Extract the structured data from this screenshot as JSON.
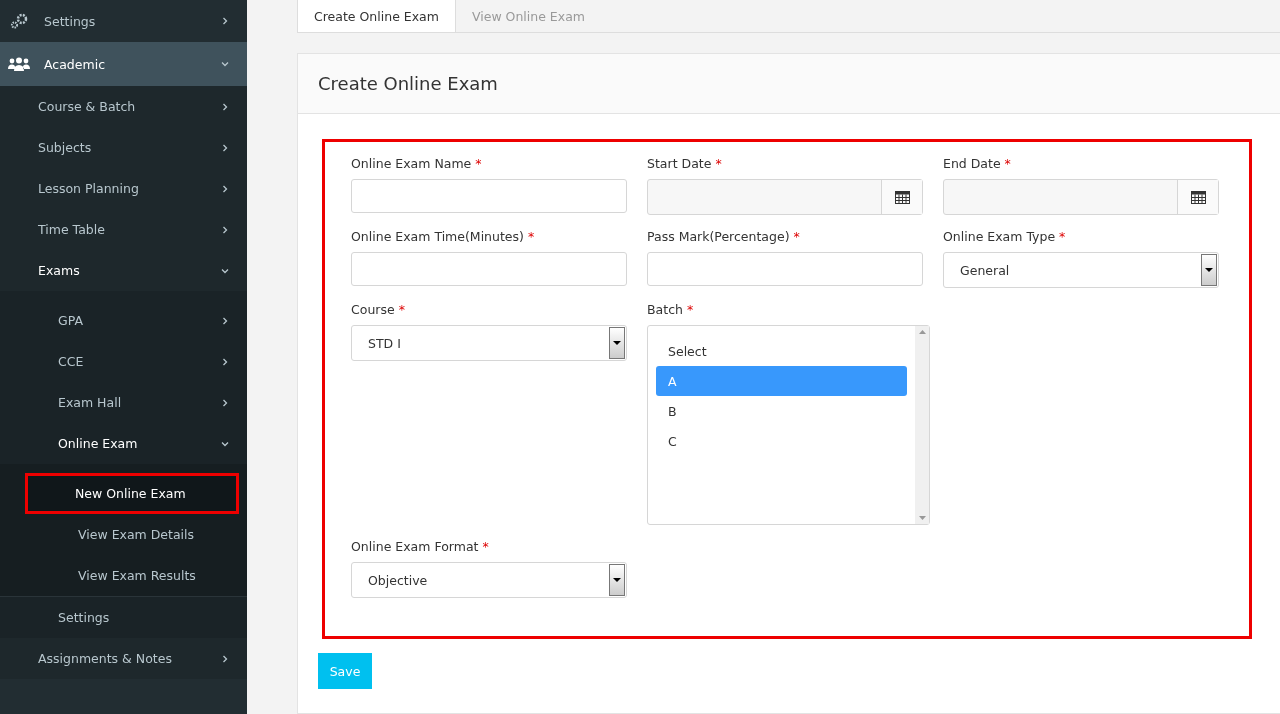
{
  "sidebar": {
    "items": [
      {
        "label": "Settings",
        "expanded": false,
        "selected": false
      },
      {
        "label": "Academic",
        "expanded": true,
        "selected": false,
        "children": [
          {
            "label": "Course & Batch",
            "expanded": false,
            "selected": false
          },
          {
            "label": "Subjects",
            "expanded": false,
            "selected": false
          },
          {
            "label": "Lesson Planning",
            "expanded": false,
            "selected": false
          },
          {
            "label": "Time Table",
            "expanded": false,
            "selected": false
          },
          {
            "label": "Exams",
            "expanded": true,
            "selected": false,
            "children": [
              {
                "label": "GPA",
                "expanded": false,
                "selected": false
              },
              {
                "label": "CCE",
                "expanded": false,
                "selected": false
              },
              {
                "label": "Exam Hall",
                "expanded": false,
                "selected": false
              },
              {
                "label": "Online Exam",
                "expanded": true,
                "selected": false,
                "children": [
                  {
                    "label": "New Online Exam",
                    "selected": true
                  },
                  {
                    "label": "View Exam Details",
                    "selected": false
                  },
                  {
                    "label": "View Exam Results",
                    "selected": false
                  }
                ]
              },
              {
                "label": "Settings",
                "selected": false
              }
            ]
          },
          {
            "label": "Assignments & Notes",
            "expanded": false,
            "selected": false
          }
        ]
      }
    ]
  },
  "tabs": [
    {
      "label": "Create Online Exam",
      "selected": true
    },
    {
      "label": "View Online Exam",
      "selected": false
    }
  ],
  "panel": {
    "title": "Create Online Exam",
    "highlighted": true,
    "rows": [
      [
        {
          "kind": "text",
          "label": "Online Exam Name",
          "mark": "*"
        },
        {
          "kind": "date",
          "label": "Start Date",
          "mark": "*"
        },
        {
          "kind": "date",
          "label": "End Date",
          "mark": "*"
        }
      ],
      [
        {
          "kind": "text",
          "label": "Online Exam Time(Minutes)",
          "mark": "*"
        },
        {
          "kind": "text",
          "label": "Pass Mark(Percentage)",
          "mark": "*"
        },
        {
          "kind": "select",
          "label": "Online Exam Type",
          "mark": "*",
          "value": "General"
        }
      ],
      [
        {
          "kind": "select",
          "label": "Course",
          "mark": "*",
          "value": "STD I"
        },
        {
          "kind": "listbox",
          "label": "Batch",
          "mark": "*",
          "options": [
            {
              "label": "Select",
              "selected": false
            },
            {
              "label": "A",
              "selected": true
            },
            {
              "label": "B",
              "selected": false
            },
            {
              "label": "C",
              "selected": false
            }
          ]
        }
      ],
      [
        {
          "kind": "select",
          "label": "Online Exam Format",
          "mark": "*",
          "value": "Objective"
        }
      ]
    ],
    "save": "Save"
  }
}
